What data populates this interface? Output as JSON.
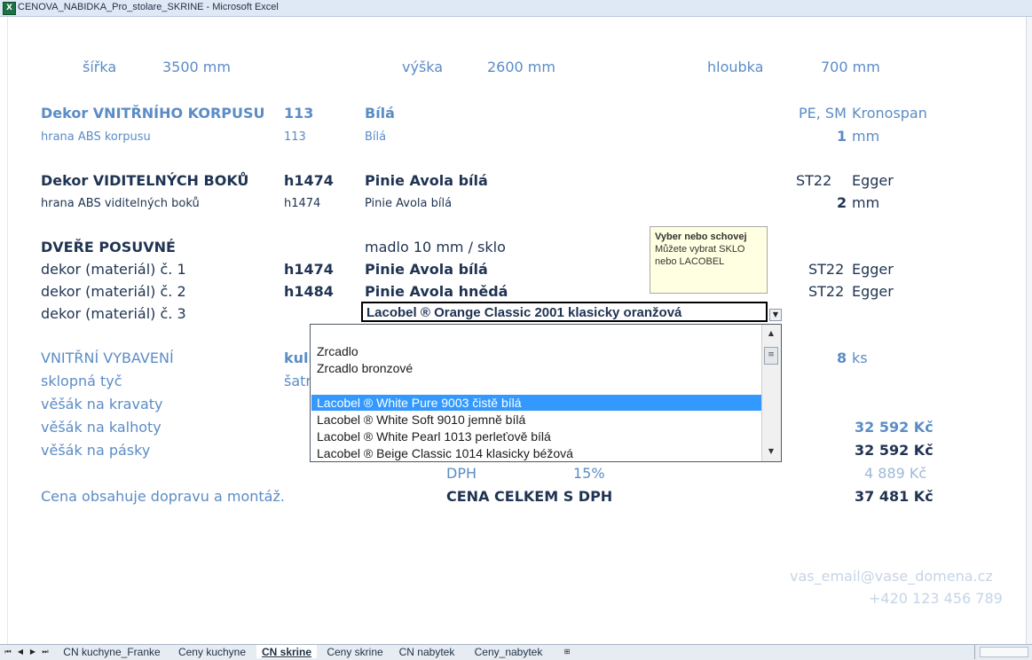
{
  "window": {
    "title": "CENOVA_NABIDKA_Pro_stolare_SKRINE - Microsoft Excel",
    "icon": "excel-icon"
  },
  "dims": {
    "sirka_label": "šířka",
    "sirka_value": "3500 mm",
    "vyska_label": "výška",
    "vyska_value": "2600 mm",
    "hloubka_label": "hloubka",
    "hloubka_value": "700 mm"
  },
  "korpus": {
    "title": "Dekor VNITŘNÍHO KORPUSU",
    "code": "113",
    "name": "Bílá",
    "type": "PE, SM",
    "supplier": "Kronospan",
    "edge_label": "hrana ABS korpusu",
    "edge_code": "113",
    "edge_name": "Bílá",
    "edge_thickness": "1",
    "edge_unit": "mm"
  },
  "boky": {
    "title": "Dekor VIDITELNÝCH BOKŮ",
    "code": "h1474",
    "name": "Pinie Avola bílá",
    "type": "ST22",
    "supplier": "Egger",
    "edge_label": "hrana ABS viditelných boků",
    "edge_code": "h1474",
    "edge_name": "Pinie Avola bílá",
    "edge_thickness": "2",
    "edge_unit": "mm"
  },
  "dvere": {
    "title": "DVEŘE POSUVNÉ",
    "handle": "madlo 10 mm / sklo",
    "rows": [
      {
        "label": "dekor (materiál) č. 1",
        "code": "h1474",
        "name": "Pinie Avola bílá",
        "type": "ST22",
        "supplier": "Egger"
      },
      {
        "label": "dekor (materiál) č. 2",
        "code": "h1484",
        "name": "Pinie Avola hnědá",
        "type": "ST22",
        "supplier": "Egger"
      },
      {
        "label": "dekor (materiál) č. 3",
        "value": "Lacobel ® Orange Classic 2001 klasicky oranžová"
      }
    ]
  },
  "comment": {
    "title": "Vyber nebo schovej",
    "line1": "Můžete vybrat SKLO",
    "line2": "nebo LACOBEL"
  },
  "dropdown": {
    "items": [
      "",
      "Zrcadlo",
      "Zrcadlo bronzové",
      "",
      "Lacobel ® White Pure 9003 čistě bílá",
      "Lacobel ® White Soft 9010 jemně bílá",
      "Lacobel ® White Pearl 1013 perleťově bílá",
      "Lacobel ® Beige Classic 1014 klasicky béžová"
    ],
    "selected_index": 4
  },
  "vybaveni": {
    "title": "VNITŘNÍ VYBAVENÍ",
    "col2_partial": "kuli",
    "qty": "8",
    "qty_unit": "ks",
    "items": [
      {
        "label": "sklopná tyč",
        "col2_partial": "šatr"
      },
      {
        "label": "věšák na kravaty"
      },
      {
        "label": "věšák na kalhoty",
        "price": "32 592 Kč"
      },
      {
        "label": "věšák na pásky",
        "price": "32 592 Kč"
      }
    ]
  },
  "totals": {
    "dph_label": "DPH",
    "dph_rate": "15%",
    "dph_value": "4 889 Kč",
    "note": "Cena obsahuje dopravu a montáž.",
    "total_label": "CENA CELKEM S DPH",
    "total_value": "37 481 Kč"
  },
  "contact": {
    "email": "vas_email@vase_domena.cz",
    "phone": "+420 123 456 789"
  },
  "sheet_tabs": [
    {
      "label": "CN kuchyne_Franke",
      "active": false
    },
    {
      "label": "Ceny kuchyne",
      "active": false
    },
    {
      "label": "CN skrine",
      "active": true
    },
    {
      "label": "Ceny skrine",
      "active": false
    },
    {
      "label": "CN nabytek",
      "active": false
    },
    {
      "label": "Ceny_nabytek",
      "active": false
    }
  ],
  "colors": {
    "accent_blue": "#5b8cc6",
    "dark_text": "#1f3352",
    "selection": "#3399ff",
    "comment_bg": "#ffffe1"
  }
}
